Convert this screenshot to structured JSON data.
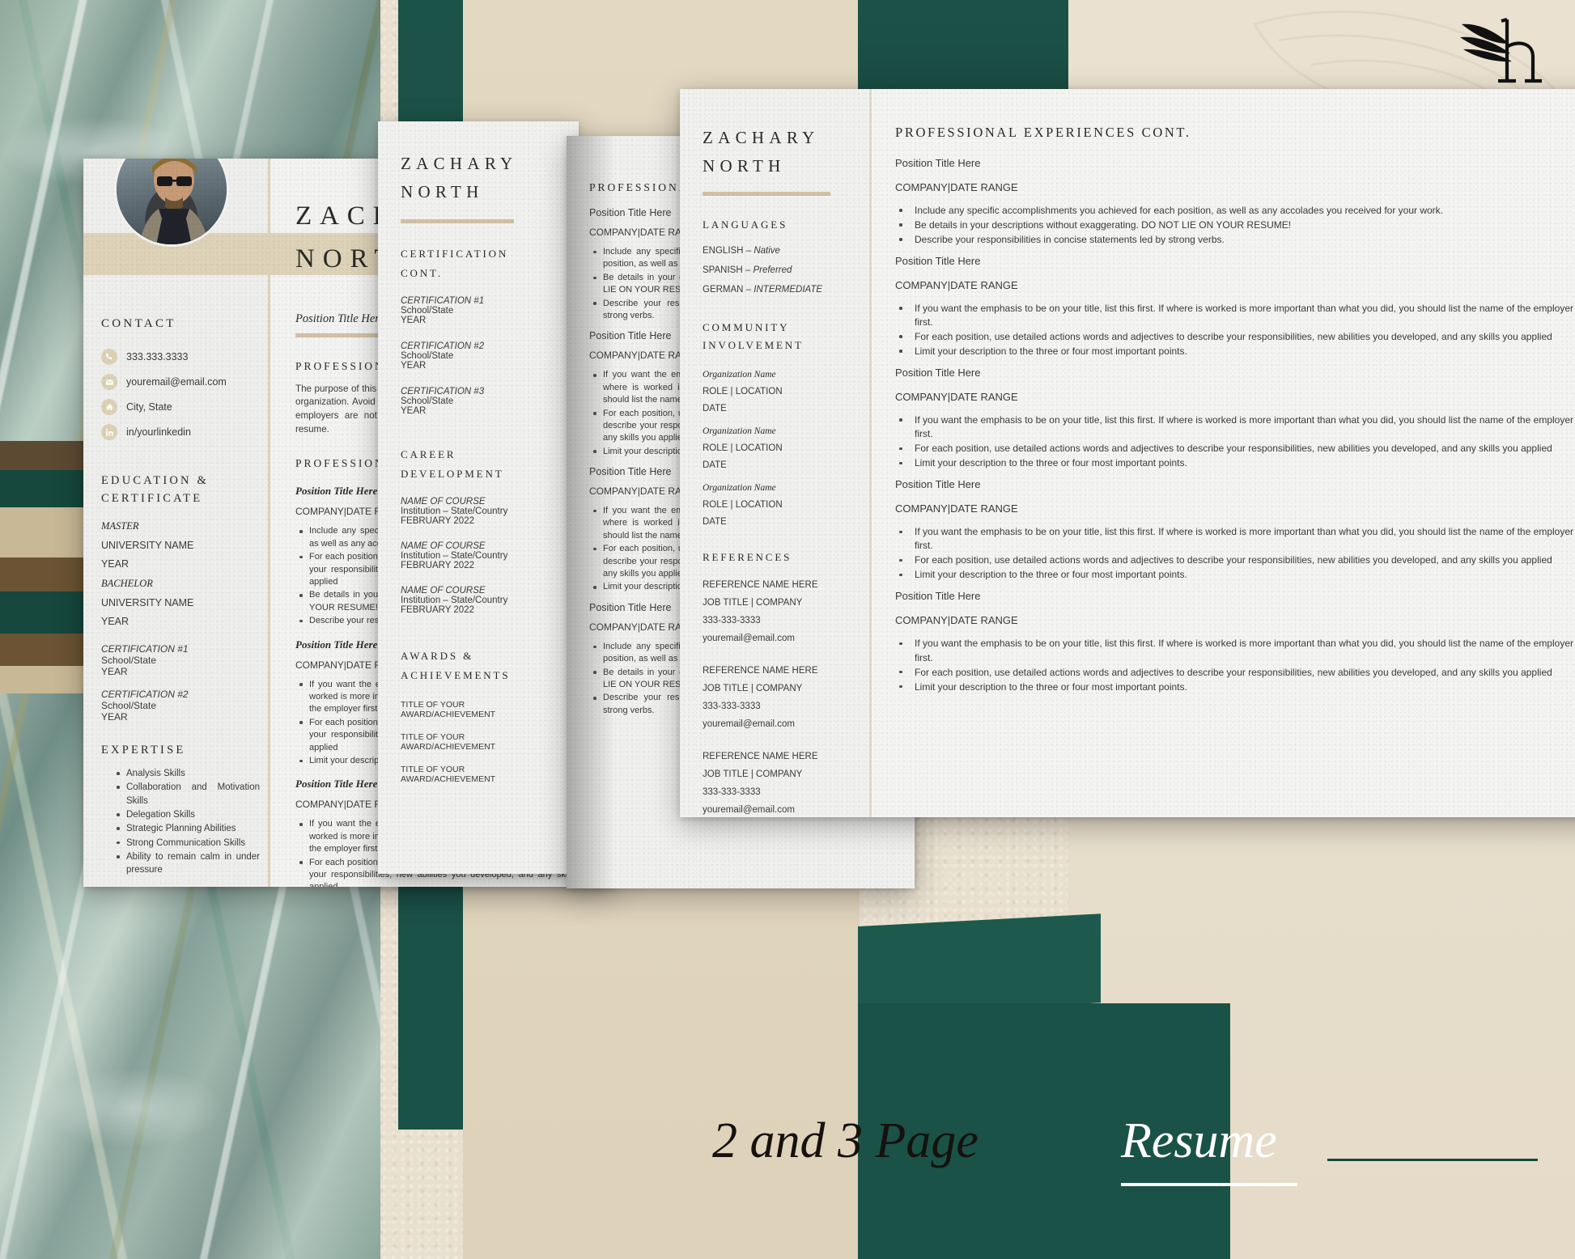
{
  "brand": {
    "logo_icon": "winged-h-logo",
    "banner_text_dark": "2 and 3 Page",
    "banner_text_light": "Resume"
  },
  "colors": {
    "gold": "#ded3b9",
    "gold_dark": "#cfc2a4",
    "green": "#1b5247",
    "ink": "#2b2b28",
    "paper": "#f2f2f0"
  },
  "page1": {
    "photo_alt": "profile-photo",
    "name_line1": "ZACHARY",
    "name_line2": "NORTH",
    "position_title": "Position Title Here",
    "contact": {
      "heading": "CONTACT",
      "items": [
        {
          "icon": "phone-icon",
          "value": "333.333.3333"
        },
        {
          "icon": "envelope-icon",
          "value": "youremail@email.com"
        },
        {
          "icon": "home-icon",
          "value": "City, State"
        },
        {
          "icon": "linkedin-icon",
          "value": "in/yourlinkedin"
        }
      ]
    },
    "education": {
      "heading_line1": "EDUCATION &",
      "heading_line2": "CERTIFICATE",
      "entries": [
        {
          "degree": "MASTER",
          "school": "UNIVERSITY NAME",
          "year": "YEAR"
        },
        {
          "degree": "BACHELOR",
          "school": "UNIVERSITY NAME",
          "year": "YEAR"
        }
      ],
      "certifications": [
        {
          "title": "CERTIFICATION #1",
          "school": "School/State",
          "year": "YEAR"
        },
        {
          "title": "CERTIFICATION #2",
          "school": "School/State",
          "year": "YEAR"
        }
      ]
    },
    "expertise": {
      "heading": "EXPERTISE",
      "items": [
        "Analysis Skills",
        "Collaboration and Motivation Skills",
        "Delegation Skills",
        "Strategic Planning Abilities",
        "Strong Communication Skills",
        "Ability to remain calm in under pressure"
      ]
    },
    "summary": {
      "heading": "PROFESSIONAL SUMMARY",
      "body": "The purpose of this section is to show employers your goals within their organization. Avoid creating a Summary that are vague or too generic, employers are not able to identify any qualities from that type of resume."
    },
    "experience": {
      "heading": "PROFESSIONAL EXPERIENCES",
      "positions": [
        {
          "title": "Position Title Here",
          "company": "COMPANY|DATE RANGE",
          "bullets": [
            "Include any specific accomplishments you achieved for each position, as well as any accolades you received for your work.",
            "For each position, use detailed actions words and adjectives to describe your responsibilities, new abilities you developed, and any skills you applied",
            "Be details in your descriptions without exaggerating. DO NOT LIE ON YOUR RESUME!",
            "Describe your responsibilities in concise statements led by strong verbs."
          ]
        },
        {
          "title": "Position Title Here",
          "company": "COMPANY|DATE RANGE",
          "bullets": [
            "If you want the emphasis to be on your title, list this first. If where is worked is more important than what you did, you should list the name of the employer first.",
            "For each position, use detailed actions words and adjectives to describe your responsibilities, new abilities you developed, and any skills you applied",
            "Limit your description to the three or four most important points."
          ]
        },
        {
          "title": "Position Title Here",
          "company": "COMPANY|DATE RANGE",
          "bullets": [
            "If you want the emphasis to be on your title, list this first. If where is worked is more important than what you did, you should list the name of the employer first.",
            "For each position, use detailed actions words and adjectives to describe your responsibilities, new abilities you developed, and any skills you applied"
          ]
        }
      ]
    }
  },
  "page2": {
    "name_line1": "ZACHARY",
    "name_line2": "NORTH",
    "certification": {
      "heading_line1": "CERTIFICATION",
      "heading_line2": "CONT.",
      "entries": [
        {
          "title": "CERTIFICATION #1",
          "school": "School/State",
          "year": "YEAR"
        },
        {
          "title": "CERTIFICATION #2",
          "school": "School/State",
          "year": "YEAR"
        },
        {
          "title": "CERTIFICATION #3",
          "school": "School/State",
          "year": "YEAR"
        }
      ]
    },
    "career_development": {
      "heading_line1": "CAREER",
      "heading_line2": "DEVELOPMENT",
      "entries": [
        {
          "course": "NAME OF COURSE",
          "institution": "Institution – State/Country",
          "date": "FEBRUARY 2022"
        },
        {
          "course": "NAME OF COURSE",
          "institution": "Institution – State/Country",
          "date": "FEBRUARY 2022"
        },
        {
          "course": "NAME OF COURSE",
          "institution": "Institution – State/Country",
          "date": "FEBRUARY 2022"
        }
      ]
    },
    "awards": {
      "heading_line1": "AWARDS &",
      "heading_line2": "ACHIEVEMENTS",
      "items": [
        "TITLE OF YOUR AWARD/ACHIEVEMENT",
        "TITLE OF YOUR AWARD/ACHIEVEMENT",
        "TITLE OF YOUR AWARD/ACHIEVEMENT"
      ]
    }
  },
  "page3": {
    "heading": "PROFESSIONAL EXPERIENCES",
    "positions": [
      {
        "title": "Position Title Here",
        "company": "COMPANY|DATE RANGE",
        "bullets": [
          "Include any specific accomplishments you achieved for each position, as well as any accolades you received for your work.",
          "Be details in your descriptions without exaggerating. DO NOT LIE ON YOUR RESUME!",
          "Describe your responsibilities in concise statements led by strong verbs."
        ]
      },
      {
        "title": "Position Title Here",
        "company": "COMPANY|DATE RANGE",
        "bullets": [
          "If you want the emphasis to be on your title, list this first. If where is worked is more important than what you did, you should list the name of the employer first.",
          "For each position, use detailed actions words and adjectives to describe your responsibilities, new abilities you developed, and any skills you applied",
          "Limit your description to the three or four most important points."
        ]
      },
      {
        "title": "Position Title Here",
        "company": "COMPANY|DATE RANGE",
        "bullets": [
          "If you want the emphasis to be on your title, list this first. If where is worked is more important than what you did, you should list the name of the employer first.",
          "For each position, use detailed actions words and adjectives to describe your responsibilities, new abilities you developed, and any skills you applied",
          "Limit your description to the three or four most important points."
        ]
      },
      {
        "title": "Position Title Here",
        "company": "COMPANY|DATE RANGE",
        "bullets": [
          "Include any specific accomplishments you achieved for each position, as well as any accolades you received for your work.",
          "Be details in your descriptions without exaggerating. DO NOT LIE ON YOUR RESUME!",
          "Describe your responsibilities in concise statements led by strong verbs."
        ]
      }
    ]
  },
  "page4": {
    "name_line1": "ZACHARY",
    "name_line2": "NORTH",
    "languages": {
      "heading": "LANGUAGES",
      "items": [
        {
          "name": "ENGLISH",
          "sep": "–",
          "level": "Native"
        },
        {
          "name": "SPANISH",
          "sep": "–",
          "level": "Preferred"
        },
        {
          "name": "GERMAN",
          "sep": "–",
          "level": "INTERMEDIATE"
        }
      ]
    },
    "community": {
      "heading_line1": "COMMUNITY",
      "heading_line2": "INVOLVEMENT",
      "entries": [
        {
          "org": "Organization Name",
          "role": "ROLE | LOCATION",
          "date": "DATE"
        },
        {
          "org": "Organization Name",
          "role": "ROLE | LOCATION",
          "date": "DATE"
        },
        {
          "org": "Organization Name",
          "role": "ROLE | LOCATION",
          "date": "DATE"
        }
      ]
    },
    "references": {
      "heading": "REFERENCES",
      "entries": [
        {
          "name": "REFERENCE NAME HERE",
          "job": "JOB TITLE | COMPANY",
          "phone": "333-333-3333",
          "email": "youremail@email.com"
        },
        {
          "name": "REFERENCE NAME HERE",
          "job": "JOB TITLE | COMPANY",
          "phone": "333-333-3333",
          "email": "youremail@email.com"
        },
        {
          "name": "REFERENCE NAME HERE",
          "job": "JOB TITLE | COMPANY",
          "phone": "333-333-3333",
          "email": "youremail@email.com"
        }
      ]
    },
    "experiences": {
      "heading": "PROFESSIONAL EXPERIENCES CONT.",
      "positions": [
        {
          "title": "Position Title Here",
          "company": "COMPANY|DATE RANGE",
          "bullets": [
            "Include any specific accomplishments you achieved for each position, as well as any accolades you received for your work.",
            "Be details in your descriptions without exaggerating.  DO NOT LIE ON YOUR RESUME!",
            "Describe your responsibilities in concise statements led by strong verbs."
          ]
        },
        {
          "title": "Position Title Here",
          "company": "COMPANY|DATE RANGE",
          "bullets": [
            "If you want the emphasis to be on your title, list this first.  If where is worked is more important than what you did, you should list the name of the employer first.",
            "For each position, use detailed actions words and adjectives to describe your responsibilities, new abilities you developed, and any skills you applied",
            "Limit your description to the three or four most important points."
          ]
        },
        {
          "title": "Position Title Here",
          "company": "COMPANY|DATE RANGE",
          "bullets": [
            "If you want the emphasis to be on your title, list this first.  If where is worked is more important than what you did, you should list the name of the employer first.",
            "For each position, use detailed actions words and adjectives to describe your responsibilities, new abilities you developed, and any skills you applied",
            "Limit your description to the three or four most important points."
          ]
        },
        {
          "title": "Position Title Here",
          "company": "COMPANY|DATE RANGE",
          "bullets": [
            "If you want the emphasis to be on your title, list this first.  If where is worked is more important than what you did, you should list the name of the employer first.",
            "For each position, use detailed actions words and adjectives to describe your responsibilities, new abilities you developed, and any skills you applied",
            "Limit your description to the three or four most important points."
          ]
        },
        {
          "title": "Position Title Here",
          "company": "COMPANY|DATE RANGE",
          "bullets": [
            "If you want the emphasis to be on your title, list this first.  If where is worked is more important than what you did, you should list the name of the employer first.",
            "For each position, use detailed actions words and adjectives to describe your responsibilities, new abilities you developed, and any skills you applied",
            "Limit your description to the three or four most important points."
          ]
        }
      ]
    }
  }
}
